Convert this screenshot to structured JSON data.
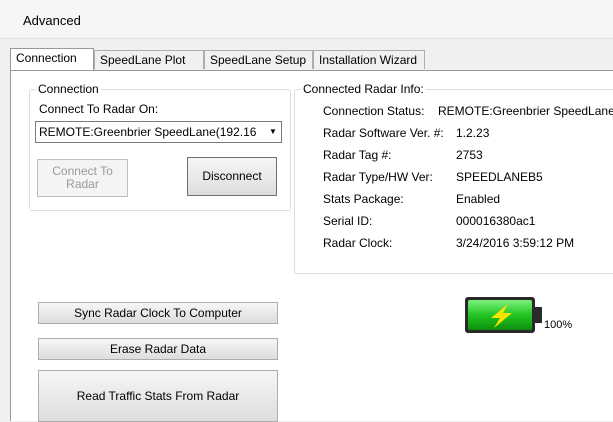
{
  "menu": {
    "advanced": "Advanced"
  },
  "tabs": [
    {
      "label": "Connection"
    },
    {
      "label": "SpeedLane Plot"
    },
    {
      "label": "SpeedLane Setup"
    },
    {
      "label": "Installation Wizard"
    }
  ],
  "connection": {
    "group_title": "Connection",
    "connect_on_label": "Connect To Radar On:",
    "combo_value": "REMOTE:Greenbrier SpeedLane(192.16",
    "connect_button": "Connect To Radar",
    "disconnect_button": "Disconnect"
  },
  "radar_info": {
    "group_title": "Connected Radar Info:",
    "rows": [
      {
        "label": "Connection Status:",
        "value": "REMOTE:Greenbrier SpeedLane"
      },
      {
        "label": "Radar Software Ver. #:",
        "value": "1.2.23"
      },
      {
        "label": "Radar Tag #:",
        "value": "2753"
      },
      {
        "label": "Radar Type/HW Ver:",
        "value": "SPEEDLANEB5"
      },
      {
        "label": "Stats Package:",
        "value": "Enabled"
      },
      {
        "label": "Serial ID:",
        "value": "000016380ac1"
      },
      {
        "label": "Radar Clock:",
        "value": "3/24/2016 3:59:12 PM"
      }
    ]
  },
  "actions": {
    "sync_clock": "Sync Radar Clock To Computer",
    "erase_data": "Erase Radar Data",
    "read_stats": "Read Traffic Stats From Radar"
  },
  "battery": {
    "level_percent": 100,
    "label": "100%",
    "color": "#22c522",
    "bolt_color": "#f5e400"
  }
}
